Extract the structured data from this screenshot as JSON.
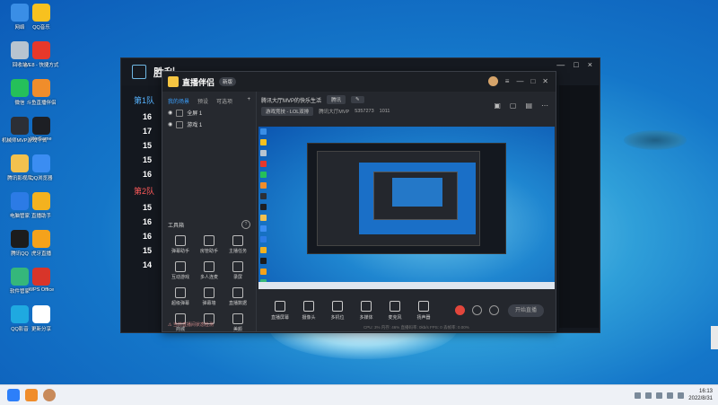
{
  "desktop": {
    "icons": [
      {
        "label": "网络",
        "name": "network-icon",
        "color": "#3a8ee6"
      },
      {
        "label": "QQ音乐",
        "name": "qq-music-icon",
        "color": "#f7c11f"
      },
      {
        "label": "回收站",
        "name": "recycle-bin-icon",
        "color": "#b8c4d0"
      },
      {
        "label": "WE8 - 快捷方式",
        "name": "we8-icon",
        "color": "#e7382a"
      },
      {
        "label": "微信",
        "name": "wechat-icon",
        "color": "#25c05a"
      },
      {
        "label": "斗鱼直播伴侣",
        "name": "douyu-icon",
        "color": "#f08d2b"
      },
      {
        "label": "机械师MVP游戏平台",
        "name": "mvp-game-icon",
        "color": "#2c2f36"
      },
      {
        "label": "WeGame",
        "name": "wegame-icon",
        "color": "#1d1f24"
      },
      {
        "label": "腾讯影视库",
        "name": "folder-icon",
        "color": "#f2c14e"
      },
      {
        "label": "QQ浏览器",
        "name": "qq-browser-icon",
        "color": "#3b8df2"
      },
      {
        "label": "电脑管家",
        "name": "pc-manager-icon",
        "color": "#2c7be5"
      },
      {
        "label": "直播助手",
        "name": "live-assistant-icon",
        "color": "#f3b21f"
      },
      {
        "label": "腾讯QQ",
        "name": "qq-icon",
        "color": "#1c1c1c"
      },
      {
        "label": "虎牙直播",
        "name": "huya-icon",
        "color": "#f4a21b"
      },
      {
        "label": "软件管家",
        "name": "software-manager-icon",
        "color": "#35b77b"
      },
      {
        "label": "WPS Office",
        "name": "wps-office-icon",
        "color": "#d8352a"
      },
      {
        "label": "QQ影音",
        "name": "qq-player-icon",
        "color": "#1fa9e0"
      },
      {
        "label": "更新分享",
        "name": "document-icon",
        "color": "#ffffff"
      }
    ]
  },
  "game_window": {
    "title": "胜利",
    "team1_label": "第1队",
    "team1_numbers": [
      "16",
      "17",
      "15",
      "15",
      "16"
    ],
    "team2_label": "第2队",
    "team2_numbers": [
      "15",
      "16",
      "16",
      "15",
      "14"
    ],
    "controls": [
      "—",
      "□",
      "×"
    ]
  },
  "stream_app": {
    "brand": "直播伴侣",
    "version": "新版",
    "tabs": [
      "我的场景",
      "预设",
      "可选项"
    ],
    "scenes": [
      "全屏 1",
      "游戏 1"
    ],
    "tools_title": "工具箱",
    "tools": [
      "弹幕助手",
      "房管助手",
      "主播任务",
      "互动游戏",
      "多人连麦",
      "录屏",
      "超级弹幕",
      "弹幕墙",
      "直播数据",
      "商城",
      "",
      "美颜"
    ],
    "notice": "⚠ 当前直播间状态检测",
    "room_title": "腾讯大厅MVP的快乐生活",
    "room_tag": "腾讯",
    "category": "游戏竞技 - LOL双排",
    "room_sub": "腾讯大厅MVP",
    "room_id": "5357273",
    "viewers": "1011",
    "toolbar": [
      {
        "label": "直播屏幕",
        "name": "screen-capture-button"
      },
      {
        "label": "摄像头",
        "name": "camera-button"
      },
      {
        "label": "多机位",
        "name": "multi-camera-button"
      },
      {
        "label": "多媒体",
        "name": "media-button"
      },
      {
        "label": "麦克风",
        "name": "microphone-button"
      },
      {
        "label": "扬声器",
        "name": "speaker-button"
      }
    ],
    "go_live": "开始直播",
    "status": "CPU: 3%    内存: 46%    直播码率: 0kb/s    FPS: 0    丢帧率: 0.00%"
  },
  "taskbar": {
    "time": "16:13",
    "date": "2022/8/31"
  },
  "colors": {
    "accent": "#3aa0ff",
    "record": "#e2463c",
    "team1": "#56b3ff",
    "team2": "#ff5a5a"
  }
}
